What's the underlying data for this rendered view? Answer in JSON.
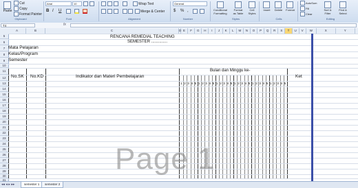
{
  "ribbon": {
    "clipboard": {
      "paste": "Paste",
      "cut": "Cut",
      "copy": "Copy",
      "format_painter": "Format Painter",
      "group": "Clipboard"
    },
    "font": {
      "name": "Arial",
      "size": "10",
      "bold": "B",
      "italic": "I",
      "underline": "U",
      "group": "Font"
    },
    "alignment": {
      "wrap_text": "Wrap Text",
      "merge_center": "Merge & Center",
      "group": "Alignment"
    },
    "number": {
      "format": "General",
      "currency": "$",
      "percent": "%",
      "comma": ",",
      "group": "Number"
    },
    "styles": {
      "conditional": "Conditional\nFormatting",
      "format_table": "Format\nas Table",
      "cell_styles": "Cell\nStyles",
      "group": "Styles"
    },
    "cells": {
      "insert": "Insert",
      "delete": "Delete",
      "format": "Format",
      "group": "Cells"
    },
    "editing": {
      "autosum": "AutoSum",
      "fill": "Fill",
      "clear": "Clear",
      "sort": "Sort &\nFilter",
      "find": "Find &\nSelect",
      "group": "Editing"
    }
  },
  "formula_bar": {
    "name_box": "T4",
    "fx": "fx",
    "value": ""
  },
  "columns": [
    "A",
    "B",
    "C",
    "D",
    "E",
    "F",
    "G",
    "H",
    "I",
    "J",
    "K",
    "L",
    "M",
    "N",
    "O",
    "P",
    "Q",
    "R",
    "S",
    "T",
    "U",
    "V",
    "W",
    "X",
    "Y",
    "Z"
  ],
  "selected_column": "T",
  "rows": [
    "5",
    "6",
    "7",
    "8",
    "9",
    "10",
    "11",
    "12",
    "13",
    "14",
    "15",
    "16",
    "17",
    "18",
    "19",
    "20",
    "21",
    "22",
    "23",
    "24",
    "25",
    "26",
    "27",
    "28",
    "29",
    "30",
    "31",
    "32"
  ],
  "document": {
    "title": "RENCANA REMEDIAL TEACHING",
    "semester_line": "SEMESTER ..............",
    "mata_pelajaran": "Mata Pelajaran",
    "kelas_program": "Kelas/Program",
    "semester": "Semester",
    "col_no_sk": "No.SK",
    "col_no_kd": "No.KD",
    "col_indikator": "Indikator dan  Materi Pembelajaran",
    "col_bulan": "Bulan  dan Minggu ke-",
    "col_ket": "Ket",
    "week_numbers": [
      "1",
      "2",
      "3",
      "4",
      "5",
      "1",
      "2",
      "3",
      "4",
      "5",
      "1",
      "2",
      "3",
      "4",
      "5",
      "1",
      "2",
      "3",
      "4",
      "5",
      "1",
      "2",
      "3",
      "4",
      "5",
      "1",
      "2",
      "3",
      "4",
      "5"
    ]
  },
  "watermark": "Page 1",
  "sheet_tabs": [
    "semester 1",
    "semester 2"
  ],
  "colors": {
    "accent": "#3b4fa8",
    "selected_header": "#f9d774"
  }
}
